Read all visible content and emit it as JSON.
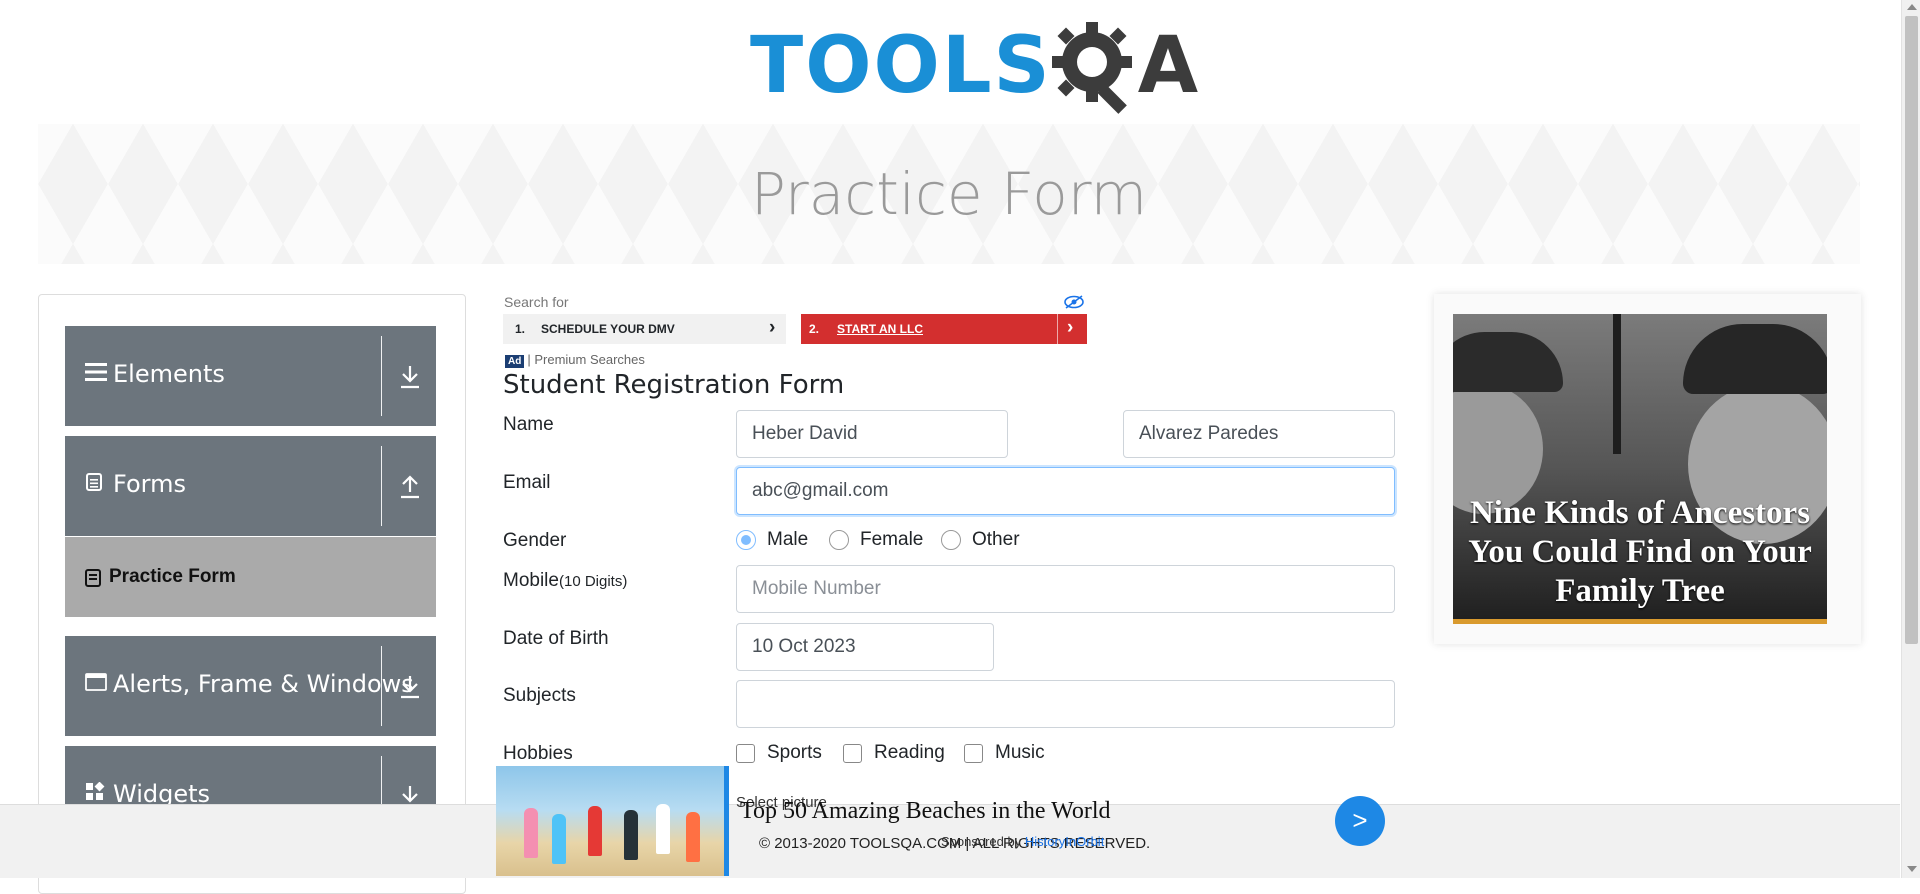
{
  "header": {
    "logo_text": "TOOLS",
    "logo_suffix": "A",
    "logo_alt": "TOOLSQA"
  },
  "banner": {
    "title": "Practice Form"
  },
  "nav": {
    "groups": [
      {
        "title": "Elements",
        "icon": "hamburger-icon",
        "toggle": "download-arrow-icon"
      },
      {
        "title": "Forms",
        "icon": "document-icon",
        "toggle": "upload-arrow-icon"
      },
      {
        "title": "Alerts, Frame & Windows",
        "icon": "window-icon",
        "toggle": "download-arrow-icon"
      },
      {
        "title": "Widgets",
        "icon": "widgets-icon",
        "toggle": "download-arrow-icon"
      }
    ],
    "active_item": {
      "label": "Practice Form",
      "icon": "form-icon"
    }
  },
  "ad_search": {
    "search_for": "Search for",
    "items": [
      {
        "num": "1.",
        "text": "SCHEDULE YOUR DMV"
      },
      {
        "num": "2.",
        "text": "START AN LLC"
      }
    ],
    "ad_badge": "Ad",
    "premium": "| Premium Searches"
  },
  "form": {
    "title": "Student Registration Form",
    "name_label": "Name",
    "first_name": "Heber David",
    "last_name": "Alvarez Paredes",
    "email_label": "Email",
    "email": "abc@gmail.com",
    "gender_label": "Gender",
    "gender_options": [
      "Male",
      "Female",
      "Other"
    ],
    "gender_selected": "Male",
    "mobile_label": "Mobile",
    "mobile_hint": "(10 Digits)",
    "mobile_placeholder": "Mobile Number",
    "dob_label": "Date of Birth",
    "dob": "10 Oct 2023",
    "subjects_label": "Subjects",
    "subjects": "",
    "hobbies_label": "Hobbies",
    "hobbies": [
      "Sports",
      "Reading",
      "Music"
    ],
    "picture_label": "Select picture"
  },
  "right_ad": {
    "caption": "Nine Kinds of Ancestors You Could Find on Your Family Tree"
  },
  "bottom_ad": {
    "title": "Top 50 Amazing Beaches in the World",
    "sponsored": "Sponsored by ",
    "sponsor": "HistoryInOrbit"
  },
  "footer": {
    "copyright": "© 2013-2020 TOOLSQA.COM | ALL RIGHTS RESERVED."
  },
  "colors": {
    "brand_blue": "#1a8fd6",
    "nav_gray": "#6c757d",
    "active_gray": "#aaaaaa",
    "ad_red": "#d32f2f"
  }
}
